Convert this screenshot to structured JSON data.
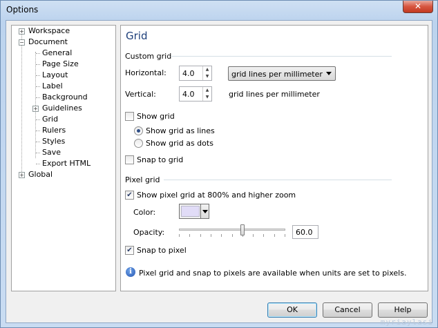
{
  "window": {
    "title": "Options",
    "close_glyph": "✕"
  },
  "tree": {
    "items": [
      {
        "label": "Workspace",
        "expander": "+"
      },
      {
        "label": "Document",
        "expander": "−"
      },
      {
        "label": "General"
      },
      {
        "label": "Page Size"
      },
      {
        "label": "Layout"
      },
      {
        "label": "Label"
      },
      {
        "label": "Background"
      },
      {
        "label": "Guidelines",
        "expander": "+"
      },
      {
        "label": "Grid",
        "selected": true
      },
      {
        "label": "Rulers"
      },
      {
        "label": "Styles"
      },
      {
        "label": "Save"
      },
      {
        "label": "Export HTML"
      },
      {
        "label": "Global",
        "expander": "+"
      }
    ]
  },
  "panel": {
    "title": "Grid",
    "custom_grid": {
      "heading": "Custom grid",
      "horizontal_label": "Horizontal:",
      "horizontal_value": "4.0",
      "horizontal_unit": "grid lines per millimeter",
      "vertical_label": "Vertical:",
      "vertical_value": "4.0",
      "vertical_unit": "grid lines per millimeter",
      "show_grid_label": "Show grid",
      "show_grid_checked": false,
      "show_as_lines_label": "Show grid as lines",
      "show_as_dots_label": "Show grid as dots",
      "show_as": "lines",
      "snap_to_grid_label": "Snap to grid",
      "snap_to_grid_checked": false
    },
    "pixel_grid": {
      "heading": "Pixel grid",
      "show_pixel_grid_label": "Show pixel grid at 800% and higher zoom",
      "show_pixel_grid_checked": true,
      "color_label": "Color:",
      "color_value": "#e1dcf7",
      "opacity_label": "Opacity:",
      "opacity_value": "60.0",
      "opacity_fraction": 0.6,
      "snap_to_pixel_label": "Snap to pixel",
      "snap_to_pixel_checked": true,
      "info_text": "Pixel grid and snap to pixels are available when units are set to pixels."
    },
    "check_glyph": "✔",
    "info_glyph": "i",
    "spin_up": "▲",
    "spin_down": "▼"
  },
  "buttons": {
    "ok": "OK",
    "cancel": "Cancel",
    "help": "Help"
  },
  "watermark": "myriaylasi",
  "colors": {
    "title_blue": "#1e3f7a",
    "accent": "#3c7fb1"
  }
}
